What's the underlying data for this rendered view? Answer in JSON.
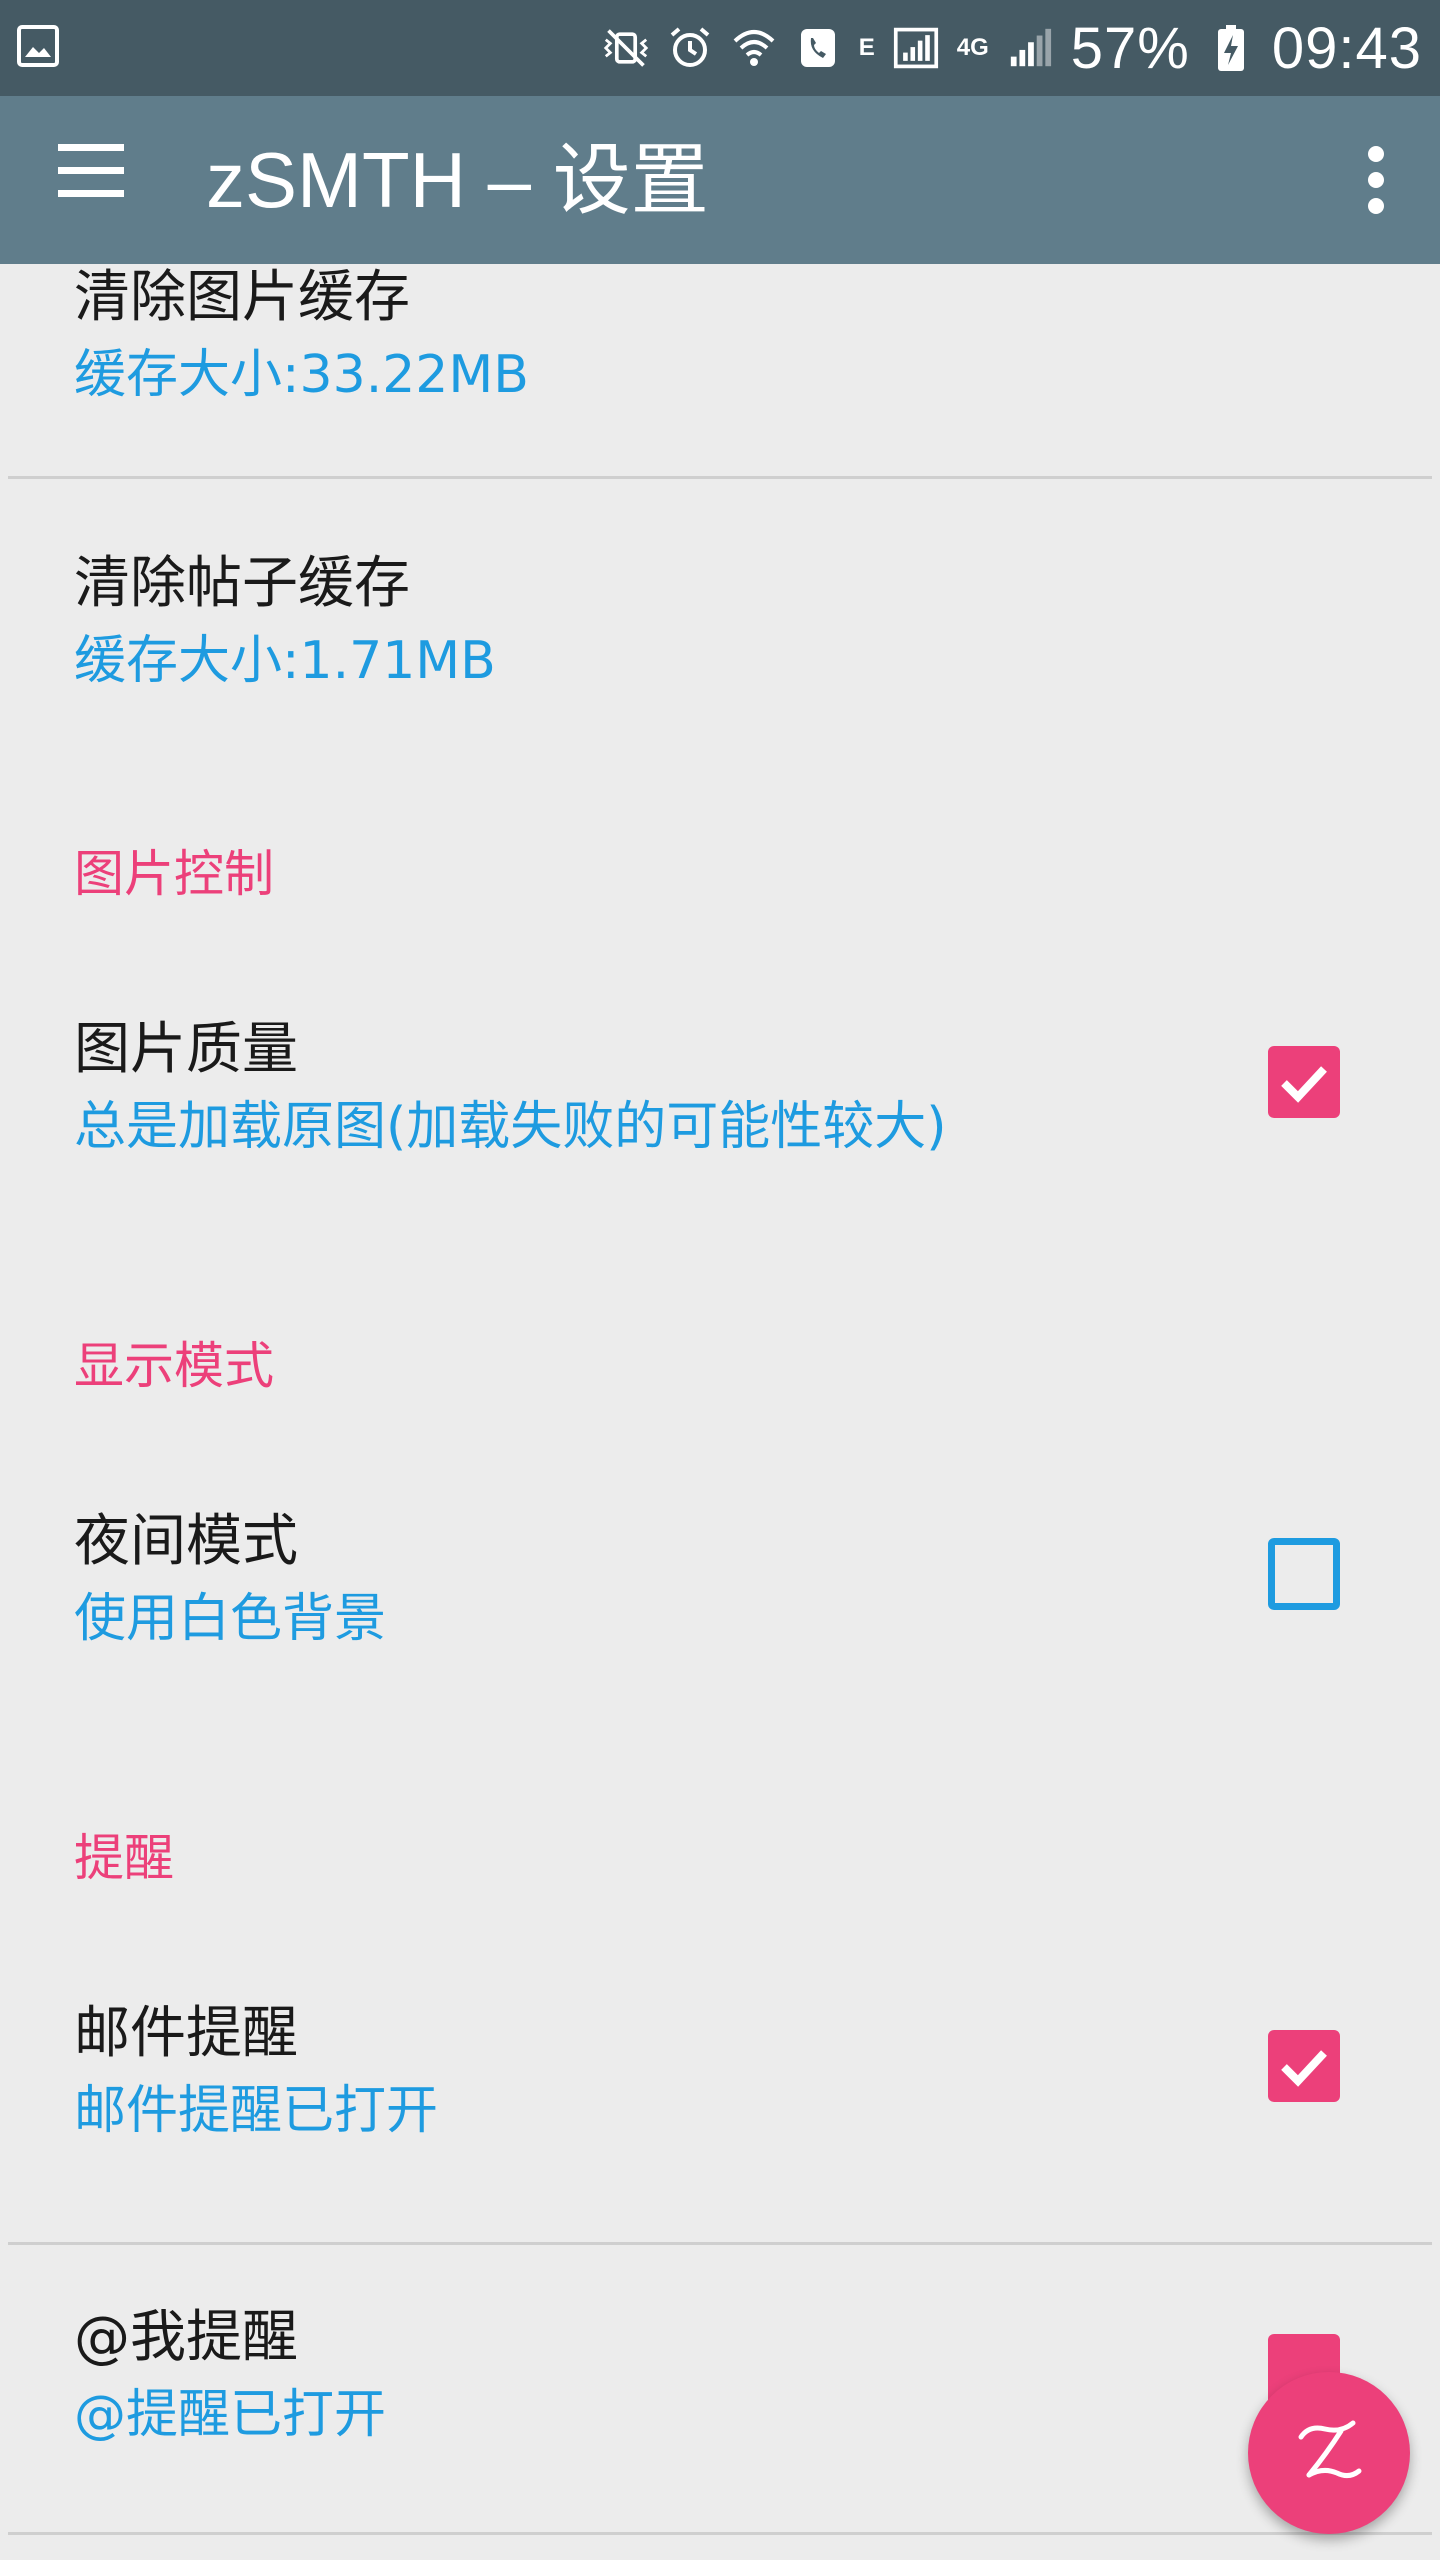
{
  "status_bar": {
    "left_icon": "gallery-icon",
    "network_label": "E",
    "network_label_2": "4G",
    "battery": "57%",
    "time": "09:43"
  },
  "app_bar": {
    "title": "zSMTH – 设置",
    "menu_icon": "hamburger-menu-icon",
    "overflow_icon": "more-vert-icon"
  },
  "prefs": {
    "clear_image_cache": {
      "title": "清除图片缓存",
      "summary": "缓存大小:33.22MB"
    },
    "clear_post_cache": {
      "title": "清除帖子缓存",
      "summary": "缓存大小:1.71MB"
    },
    "cat_image": "图片控制",
    "image_quality": {
      "title": "图片质量",
      "summary": "总是加载原图(加载失败的可能性较大)",
      "checked": true
    },
    "cat_display": "显示模式",
    "night_mode": {
      "title": "夜间模式",
      "summary": "使用白色背景",
      "checked": false
    },
    "cat_remind": "提醒",
    "mail_remind": {
      "title": "邮件提醒",
      "summary": "邮件提醒已打开",
      "checked": true
    },
    "at_remind": {
      "title": "@我提醒",
      "summary": "@提醒已打开",
      "checked": true
    }
  },
  "colors": {
    "status_bar": "#455a64",
    "app_bar": "#607d8b",
    "accent": "#ec407a",
    "summary": "#1e9be0",
    "background": "#ececec"
  },
  "fab": {
    "icon": "zsmth-logo-icon"
  }
}
